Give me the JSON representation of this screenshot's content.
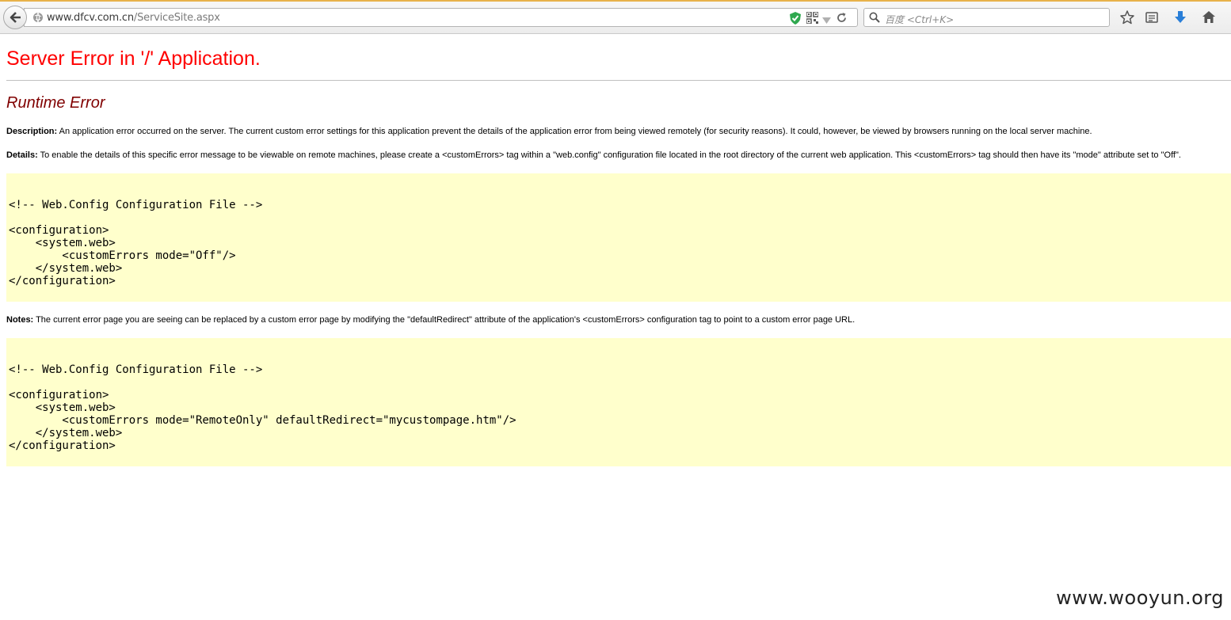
{
  "browser": {
    "url_host": "www.dfcv.com.cn",
    "url_path": "/ServiceSite.aspx",
    "search_placeholder": "百度 <Ctrl+K>"
  },
  "page": {
    "title": "Server Error in '/' Application.",
    "subtitle": "Runtime Error",
    "description_label": "Description:",
    "description_text": " An application error occurred on the server. The current custom error settings for this application prevent the details of the application error from being viewed remotely (for security reasons). It could, however, be viewed by browsers running on the local server machine.",
    "details_label": "Details:",
    "details_text": " To enable the details of this specific error message to be viewable on remote machines, please create a <customErrors> tag within a \"web.config\" configuration file located in the root directory of the current web application. This <customErrors> tag should then have its \"mode\" attribute set to \"Off\".",
    "code1": "<!-- Web.Config Configuration File -->\n\n<configuration>\n    <system.web>\n        <customErrors mode=\"Off\"/>\n    </system.web>\n</configuration>",
    "notes_label": "Notes:",
    "notes_text": " The current error page you are seeing can be replaced by a custom error page by modifying the \"defaultRedirect\" attribute of the application's <customErrors> configuration tag to point to a custom error page URL.",
    "code2": "<!-- Web.Config Configuration File -->\n\n<configuration>\n    <system.web>\n        <customErrors mode=\"RemoteOnly\" defaultRedirect=\"mycustompage.htm\"/>\n    </system.web>\n</configuration>"
  },
  "watermark": "www.wooyun.org"
}
